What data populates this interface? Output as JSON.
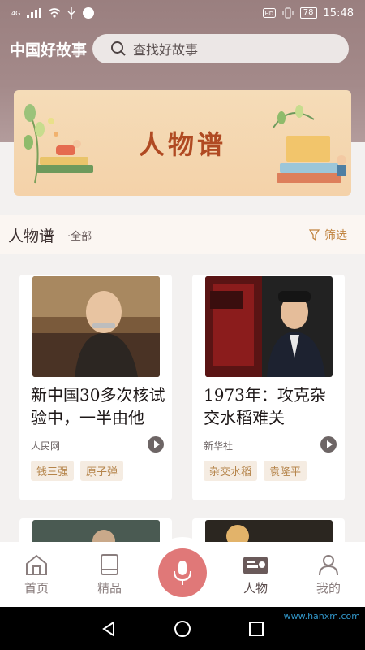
{
  "status": {
    "network": "4G",
    "battery": "78",
    "time": "15:48"
  },
  "header": {
    "app_title": "中国好故事",
    "search_placeholder": "查找好故事"
  },
  "banner": {
    "title": "人物谱"
  },
  "section": {
    "title": "人物谱",
    "subtitle": "·全部",
    "filter_label": "筛选"
  },
  "cards": [
    {
      "title": "新中国30多次核试验中，一半由他",
      "source": "人民网",
      "tags": [
        "钱三强",
        "原子弹"
      ]
    },
    {
      "title": "1973年：攻克杂交水稻难关",
      "source": "新华社",
      "tags": [
        "杂交水稻",
        "袁隆平"
      ]
    }
  ],
  "nav": {
    "home": "首页",
    "featured": "精品",
    "people": "人物",
    "mine": "我的"
  },
  "watermark": "www.hanxm.com",
  "colors": {
    "header": "#9a7f7f",
    "accent": "#e07878",
    "tag_text": "#b5844a",
    "banner_title": "#b04a22"
  }
}
